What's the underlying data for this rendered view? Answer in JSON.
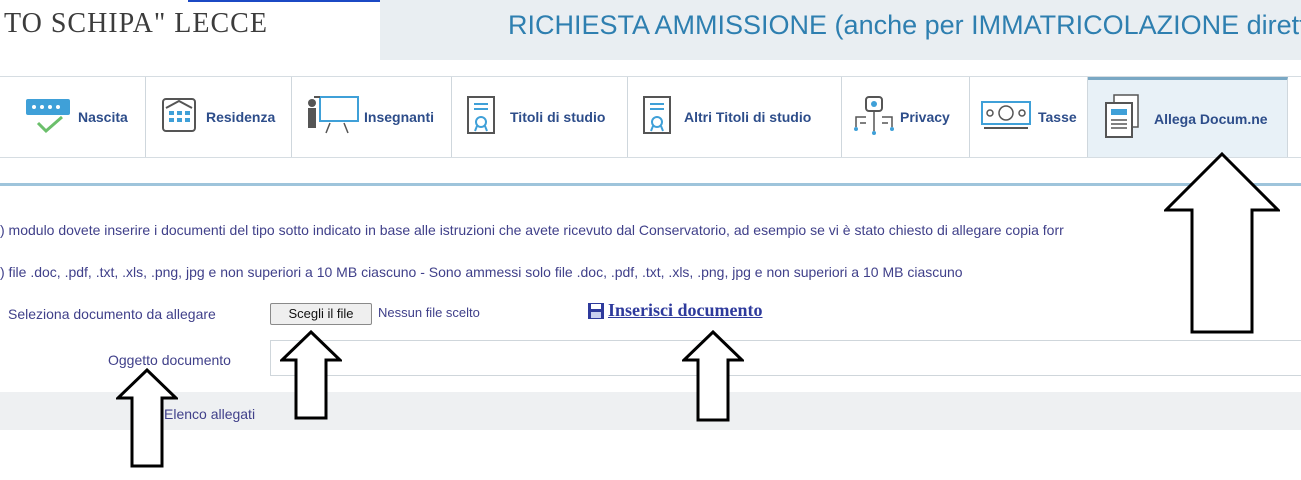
{
  "header": {
    "institution": "TO SCHIPA\" LECCE",
    "title": "RICHIESTA AMMISSIONE (anche per IMMATRICOLAZIONE diretta -"
  },
  "tabs": [
    {
      "label": "Nascita",
      "icon": "keyboard-check-icon"
    },
    {
      "label": "Residenza",
      "icon": "building-icon"
    },
    {
      "label": "Insegnanti",
      "icon": "teacher-board-icon"
    },
    {
      "label": "Titoli di studio",
      "icon": "certificate-icon"
    },
    {
      "label": "Altri Titoli di studio",
      "icon": "certificate-icon"
    },
    {
      "label": "Privacy",
      "icon": "network-key-icon"
    },
    {
      "label": "Tasse",
      "icon": "banknote-icon"
    },
    {
      "label": "Allega Docum.ne",
      "icon": "documents-icon",
      "active": true
    }
  ],
  "info": {
    "line1": ") modulo dovete inserire i documenti del tipo sotto indicato in base alle istruzioni che avete ricevuto dal Conservatorio, ad esempio se vi è stato chiesto di allegare copia forr",
    "line2": ") file .doc, .pdf, .txt, .xls, .png, jpg e non superiori a 10 MB ciascuno - Sono ammessi solo file .doc, .pdf, .txt, .xls, .png, jpg e non superiori a 10 MB ciascuno"
  },
  "form": {
    "select_label": "Seleziona documento da allegare",
    "choose_button": "Scegli il file",
    "no_file": "Nessun file scelto",
    "insert_link": "Inserisci documento",
    "object_label": "Oggetto documento",
    "object_value": "",
    "attachments_label": "Elenco allegati"
  },
  "colors": {
    "accent": "#2e7fb0",
    "link": "#2e3a9c",
    "text": "#40408a"
  }
}
